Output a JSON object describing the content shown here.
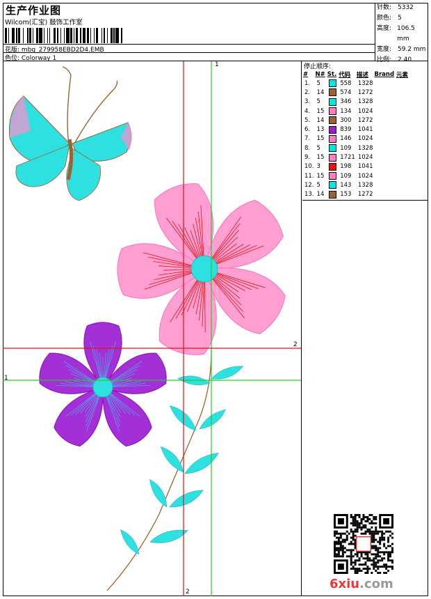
{
  "header": {
    "title": "生产作业图",
    "company": "Wilcom(汇宝) 鼓饰工作室",
    "pattern_label": "花版:",
    "pattern_value": "mbg_279958EBD2D4.EMB",
    "colorway_label": "色位:",
    "colorway_value": "Colorway 1"
  },
  "stats": [
    {
      "label": "针数:",
      "value": "5332"
    },
    {
      "label": "颜色:",
      "value": "5"
    },
    {
      "label": "高度:",
      "value": "106.5 mm"
    },
    {
      "label": "宽度:",
      "value": "59.2 mm"
    },
    {
      "label": "比例:",
      "value": "2.40"
    }
  ],
  "stop_sequence": {
    "title": "停止顺序:",
    "headers": [
      "#",
      "N#",
      "St.",
      "代码",
      "描述",
      "Brand",
      "元素"
    ],
    "rows": [
      {
        "idx": "1.",
        "n": "5",
        "color": "#00e5e5",
        "st": "558",
        "code": "1328"
      },
      {
        "idx": "2.",
        "n": "14",
        "color": "#9a6430",
        "st": "574",
        "code": "1272"
      },
      {
        "idx": "3.",
        "n": "5",
        "color": "#00e5e5",
        "st": "346",
        "code": "1328"
      },
      {
        "idx": "4.",
        "n": "15",
        "color": "#ff80c0",
        "st": "134",
        "code": "1024"
      },
      {
        "idx": "5.",
        "n": "14",
        "color": "#9a6430",
        "st": "300",
        "code": "1272"
      },
      {
        "idx": "6.",
        "n": "13",
        "color": "#9a1fc8",
        "st": "839",
        "code": "1041"
      },
      {
        "idx": "7.",
        "n": "15",
        "color": "#ff80c0",
        "st": "146",
        "code": "1024"
      },
      {
        "idx": "8.",
        "n": "5",
        "color": "#00e5e5",
        "st": "109",
        "code": "1328"
      },
      {
        "idx": "9.",
        "n": "15",
        "color": "#ff80c0",
        "st": "1721",
        "code": "1024"
      },
      {
        "idx": "10.",
        "n": "3",
        "color": "#ee1010",
        "st": "198",
        "code": "1041"
      },
      {
        "idx": "11.",
        "n": "15",
        "color": "#ff80c0",
        "st": "109",
        "code": "1024"
      },
      {
        "idx": "12.",
        "n": "5",
        "color": "#00e5e5",
        "st": "143",
        "code": "1328"
      },
      {
        "idx": "13.",
        "n": "14",
        "color": "#9a6430",
        "st": "153",
        "code": "1272"
      }
    ]
  },
  "guides": {
    "green_label_top": "1",
    "green_label_left": "1",
    "red_label_right": "2",
    "red_label_bottom": "2"
  },
  "watermark": {
    "site_prefix": "6xiu",
    "site_suffix": ".com"
  },
  "colors": {
    "cyan": "#2fe0e0",
    "pink": "#ff8ccc",
    "purple": "#9a1fc8",
    "brown": "#9a6430",
    "red": "#ee1010",
    "guide_green": "#22cc22",
    "guide_red": "#e01010"
  }
}
